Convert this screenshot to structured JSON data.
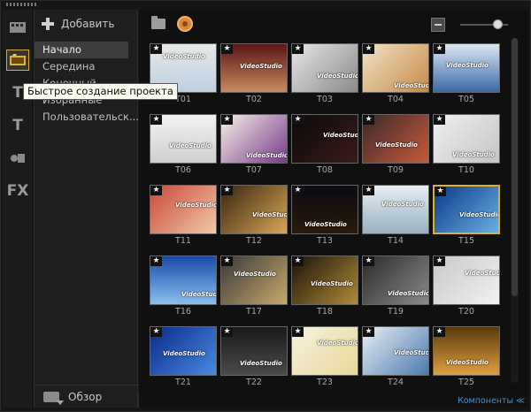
{
  "sidebar": {
    "add_label": "Добавить",
    "categories": [
      "Начало",
      "Середина",
      "Конечный",
      "Избранные",
      "Пользовательск..."
    ],
    "browse_label": "Обзор"
  },
  "rail": {
    "icons": [
      "media-icon",
      "instant-project-icon",
      "title-icon",
      "text-icon",
      "graphics-icon",
      "fx-icon"
    ],
    "title_glyph": "T",
    "fx_glyph": "FX"
  },
  "tooltip": {
    "text": "Быстрое создание проекта"
  },
  "collapse_glyph": "«",
  "templates": {
    "selected": "T15",
    "star_glyph": "★",
    "watermark": "VideoStudio",
    "items": [
      {
        "label": "T01",
        "bg": "linear-gradient(180deg,#e8e8e8,#bcd0e0)"
      },
      {
        "label": "T02",
        "bg": "linear-gradient(180deg,#5a1616,#c88a60)"
      },
      {
        "label": "T03",
        "bg": "linear-gradient(135deg,#e6e6e6,#8a8a8a)"
      },
      {
        "label": "T04",
        "bg": "linear-gradient(135deg,#f0e2c8,#c88a48)"
      },
      {
        "label": "T05",
        "bg": "linear-gradient(180deg,#dbe6f2,#3a6aa8)"
      },
      {
        "label": "T06",
        "bg": "linear-gradient(180deg,#f2f2f2,#cfcfcf)"
      },
      {
        "label": "T07",
        "bg": "linear-gradient(135deg,#f4f0e8,#7a3a8a)"
      },
      {
        "label": "T08",
        "bg": "linear-gradient(135deg,#0a0a0a,#3a1a1a)"
      },
      {
        "label": "T09",
        "bg": "linear-gradient(135deg,#3a2a2a,#c85a3a)"
      },
      {
        "label": "T10",
        "bg": "linear-gradient(135deg,#f0f0f0,#c4c4c4)"
      },
      {
        "label": "T11",
        "bg": "linear-gradient(135deg,#c84a3a,#f2c8a8)"
      },
      {
        "label": "T12",
        "bg": "linear-gradient(135deg,#3a2612,#d8a658)"
      },
      {
        "label": "T13",
        "bg": "linear-gradient(180deg,#0a0a14,#2a1a0a)"
      },
      {
        "label": "T14",
        "bg": "linear-gradient(180deg,#e6eef2,#9ab0c0)"
      },
      {
        "label": "T15",
        "bg": "linear-gradient(135deg,#0a3a8a,#6aaee0)"
      },
      {
        "label": "T16",
        "bg": "linear-gradient(180deg,#1a4aa8,#8ac0f0)"
      },
      {
        "label": "T17",
        "bg": "linear-gradient(135deg,#3a3a3a,#c8a86a)"
      },
      {
        "label": "T18",
        "bg": "linear-gradient(135deg,#1a1408,#b08a3a)"
      },
      {
        "label": "T19",
        "bg": "linear-gradient(135deg,#2a2a2a,#8a8a8a)"
      },
      {
        "label": "T20",
        "bg": "linear-gradient(135deg,#c8c8c8,#f2f2f2)"
      },
      {
        "label": "T21",
        "bg": "linear-gradient(135deg,#0a2a8a,#4a8ae0)"
      },
      {
        "label": "T22",
        "bg": "linear-gradient(180deg,#1a1a1a,#4a4a4a)"
      },
      {
        "label": "T23",
        "bg": "linear-gradient(135deg,#f6f2e0,#e8d898)"
      },
      {
        "label": "T24",
        "bg": "linear-gradient(135deg,#e8eef2,#4a7ab0)"
      },
      {
        "label": "T25",
        "bg": "linear-gradient(180deg,#5a3a0a,#e0a040)"
      }
    ]
  },
  "status": {
    "text": "Компоненты ≪"
  },
  "colors": {
    "accent": "#d6a73a",
    "selection": "#e0b028",
    "status": "#3f8fd1"
  }
}
